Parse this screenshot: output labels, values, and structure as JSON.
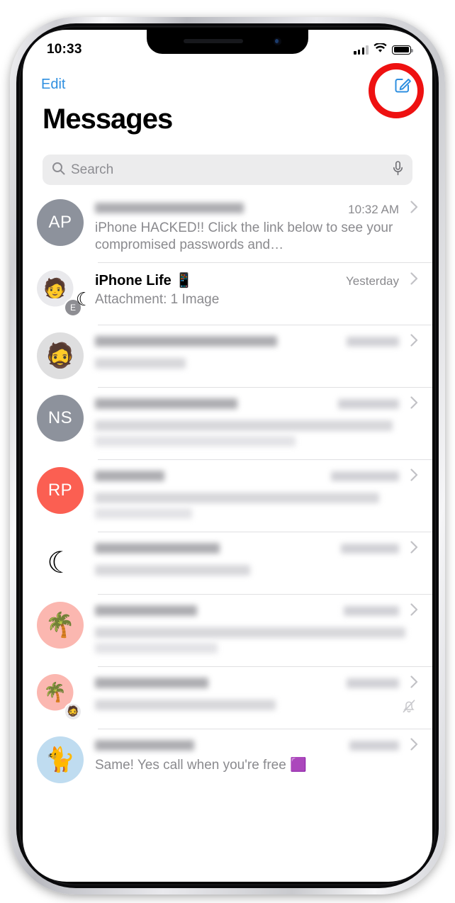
{
  "device": {
    "frame": "iphone-silver",
    "accent_annotation_color": "#ee1111"
  },
  "status_bar": {
    "time": "10:33",
    "signal_icon": "cellular-bars-icon",
    "signal_bars_filled": 3,
    "signal_bars_total": 4,
    "wifi_icon": "wifi-icon",
    "battery_icon": "battery-full-icon"
  },
  "nav": {
    "edit_label": "Edit",
    "compose_icon": "compose-new-message-icon",
    "compose_accent": "#2e8fe0"
  },
  "header": {
    "title": "Messages"
  },
  "search": {
    "placeholder": "Search",
    "search_icon": "search-icon",
    "dictation_icon": "microphone-icon"
  },
  "conversations": [
    {
      "id": "row-1",
      "avatar_type": "initials",
      "avatar_initials": "AP",
      "avatar_color": "#8d929c",
      "name_redacted": true,
      "name": "",
      "time": "10:32 AM",
      "time_redacted": false,
      "preview": "iPhone HACKED!! Click the link below to see your compromised passwords and…",
      "preview_redacted": false,
      "dnd": false,
      "muted": false,
      "chevron_icon": "chevron-right-icon"
    },
    {
      "id": "row-2",
      "avatar_type": "emoji-group",
      "avatar_emoji": "🧑",
      "avatar_badge": "E",
      "avatar_color": "#e9e9ec",
      "name_redacted": false,
      "name": "iPhone Life 📱",
      "time": "Yesterday",
      "time_redacted": false,
      "preview": "Attachment: 1 Image",
      "preview_redacted": false,
      "dnd": true,
      "muted": false,
      "chevron_icon": "chevron-right-icon"
    },
    {
      "id": "row-3",
      "avatar_type": "emoji",
      "avatar_emoji": "🧔",
      "avatar_color": "#dededf",
      "name_redacted": true,
      "name": "",
      "time": "",
      "time_redacted": true,
      "preview": "",
      "preview_redacted": true,
      "dnd": false,
      "muted": false,
      "chevron_icon": "chevron-right-icon"
    },
    {
      "id": "row-4",
      "avatar_type": "initials",
      "avatar_initials": "NS",
      "avatar_color": "#8d929c",
      "name_redacted": true,
      "name": "",
      "time": "",
      "time_redacted": true,
      "preview": "",
      "preview_redacted": true,
      "dnd": false,
      "muted": false,
      "chevron_icon": "chevron-right-icon"
    },
    {
      "id": "row-5",
      "avatar_type": "initials",
      "avatar_initials": "RP",
      "avatar_color": "#fb5f52",
      "name_redacted": true,
      "name": "",
      "time": "",
      "time_redacted": true,
      "preview": "",
      "preview_redacted": true,
      "dnd": false,
      "muted": false,
      "chevron_icon": "chevron-right-icon"
    },
    {
      "id": "row-6",
      "avatar_type": "moon-only",
      "avatar_emoji": "",
      "avatar_color": "",
      "name_redacted": true,
      "name": "",
      "time": "",
      "time_redacted": true,
      "preview": "",
      "preview_redacted": true,
      "dnd": true,
      "muted": false,
      "chevron_icon": "chevron-right-icon"
    },
    {
      "id": "row-7",
      "avatar_type": "emoji",
      "avatar_emoji": "🌴",
      "avatar_color": "#fbb7b0",
      "name_redacted": true,
      "name": "",
      "time": "",
      "time_redacted": true,
      "preview": "",
      "preview_redacted": true,
      "dnd": false,
      "muted": false,
      "chevron_icon": "chevron-right-icon"
    },
    {
      "id": "row-8",
      "avatar_type": "emoji-group",
      "avatar_emoji": "🌴",
      "avatar_badge": "🧔",
      "avatar_color": "#fbb7b0",
      "name_redacted": true,
      "name": "",
      "time": "",
      "time_redacted": true,
      "preview": "",
      "preview_redacted": true,
      "dnd": false,
      "muted": true,
      "mute_icon": "bell-slash-icon",
      "chevron_icon": "chevron-right-icon"
    },
    {
      "id": "row-9",
      "avatar_type": "emoji",
      "avatar_emoji": "🐈",
      "avatar_color": "#bfdcf0",
      "name_redacted": true,
      "name": "",
      "time": "",
      "time_redacted": true,
      "preview": "Same! Yes call when you're free 🟪",
      "preview_redacted": false,
      "dnd": false,
      "muted": false,
      "chevron_icon": "chevron-right-icon"
    }
  ]
}
